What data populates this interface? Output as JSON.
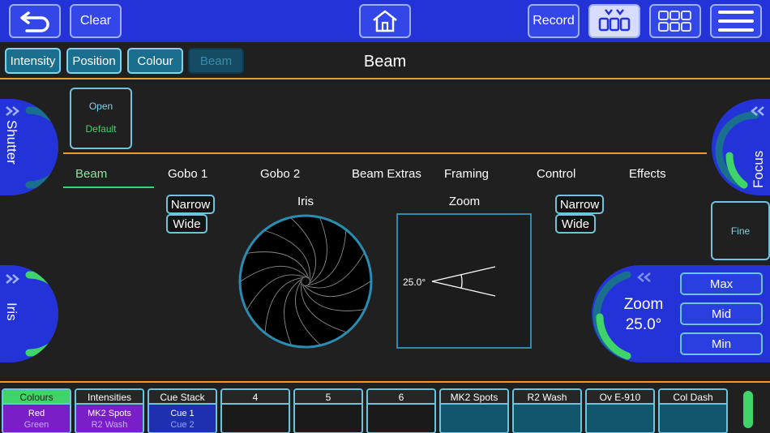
{
  "topbar": {
    "back_icon": "undo-arrow-icon",
    "clear_label": "Clear",
    "home_icon": "home-icon",
    "record_label": "Record",
    "palette_icon": "palette-grid-icon",
    "grid_icon": "grid-icon",
    "menu_icon": "menu-icon"
  },
  "categories": [
    {
      "label": "Intensity"
    },
    {
      "label": "Position"
    },
    {
      "label": "Colour"
    },
    {
      "label": "Beam"
    }
  ],
  "page_title": "Beam",
  "shutter": {
    "label": "Shutter",
    "line1": "Open",
    "line2": "Default"
  },
  "focus": {
    "label": "Focus"
  },
  "fine_label": "Fine",
  "tabs": [
    "Beam",
    "Gobo 1",
    "Gobo 2",
    "Beam Extras",
    "Framing",
    "Control",
    "Effects"
  ],
  "iris": {
    "title": "Iris",
    "narrow": "Narrow",
    "wide": "Wide",
    "side_label": "Iris"
  },
  "zoom": {
    "title": "Zoom",
    "angle_label": "25.0°",
    "narrow": "Narrow",
    "wide": "Wide",
    "encoder_title": "Zoom",
    "encoder_value": "25.0°",
    "max": "Max",
    "mid": "Mid",
    "min": "Min"
  },
  "bottom": {
    "slots": [
      {
        "title": "Colours",
        "line1": "Red",
        "line2": "Green",
        "color": "#7a1fc8",
        "line2color": "#c7a8ff"
      },
      {
        "title": "Intensities",
        "line1": "MK2 Spots",
        "line2": "R2 Wash",
        "color": "#7a1fc8",
        "line2color": "#c7a8ff"
      },
      {
        "title": "Cue Stack",
        "line1": "Cue 1",
        "line2": "Cue 2",
        "color": "#1e2fb0",
        "line2color": "#9aa6ff"
      },
      {
        "title": "4",
        "line1": "",
        "line2": "",
        "color": "#1a1a1a",
        "line2color": "#aaa"
      },
      {
        "title": "5",
        "line1": "",
        "line2": "",
        "color": "#1a1a1a",
        "line2color": "#aaa"
      },
      {
        "title": "6",
        "line1": "",
        "line2": "",
        "color": "#1a1a1a",
        "line2color": "#aaa"
      },
      {
        "title": "MK2 Spots",
        "line1": "",
        "line2": "",
        "color": "#12566e",
        "line2color": "#aaa"
      },
      {
        "title": "R2 Wash",
        "line1": "",
        "line2": "",
        "color": "#12566e",
        "line2color": "#aaa"
      },
      {
        "title": "Ov E-910",
        "line1": "",
        "line2": "",
        "color": "#12566e",
        "line2color": "#aaa"
      },
      {
        "title": "Col Dash",
        "line1": "",
        "line2": "",
        "color": "#12566e",
        "line2color": "#aaa"
      }
    ]
  }
}
